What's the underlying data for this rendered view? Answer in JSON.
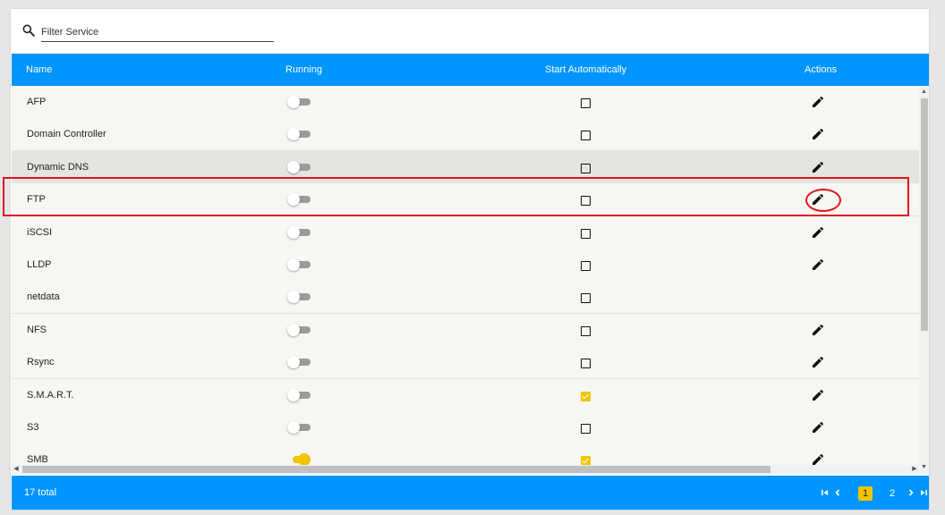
{
  "filter": {
    "placeholder": "Filter Service",
    "icon": "search-icon"
  },
  "table": {
    "headers": {
      "name": "Name",
      "running": "Running",
      "start_automatically": "Start Automatically",
      "actions": "Actions"
    },
    "rows": [
      {
        "name": "AFP",
        "running": false,
        "start_automatically": false,
        "editable": true
      },
      {
        "name": "Domain Controller",
        "running": false,
        "start_automatically": false,
        "editable": true
      },
      {
        "name": "Dynamic DNS",
        "running": false,
        "start_automatically": false,
        "editable": true,
        "hovered": true
      },
      {
        "name": "FTP",
        "running": false,
        "start_automatically": false,
        "editable": true,
        "highlighted": true
      },
      {
        "name": "iSCSI",
        "running": false,
        "start_automatically": false,
        "editable": true
      },
      {
        "name": "LLDP",
        "running": false,
        "start_automatically": false,
        "editable": true
      },
      {
        "name": "netdata",
        "running": false,
        "start_automatically": false,
        "editable": false
      },
      {
        "name": "NFS",
        "running": false,
        "start_automatically": false,
        "editable": true
      },
      {
        "name": "Rsync",
        "running": false,
        "start_automatically": false,
        "editable": true
      },
      {
        "name": "S.M.A.R.T.",
        "running": false,
        "start_automatically": true,
        "editable": true
      },
      {
        "name": "S3",
        "running": false,
        "start_automatically": false,
        "editable": true
      },
      {
        "name": "SMB",
        "running": true,
        "start_automatically": true,
        "editable": true
      }
    ]
  },
  "footer": {
    "total": "17 total",
    "pages": [
      "1",
      "2"
    ],
    "current_page": "1"
  },
  "colors": {
    "header_bg": "#0095ff",
    "accent": "#f0c400",
    "annotation": "#e0141e"
  }
}
